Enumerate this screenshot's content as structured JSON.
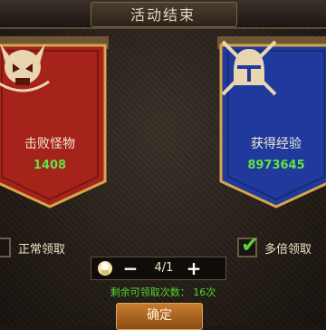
{
  "title": "活动结束",
  "left_banner": {
    "label": "击败怪物",
    "value": "1408",
    "icon": "demon-skull-icon",
    "color": "#b3261c"
  },
  "right_banner": {
    "label": "获得经验",
    "value": "8973645",
    "icon": "knight-helmet-swords-icon",
    "color": "#1f3a9c"
  },
  "options": {
    "normal": {
      "label": "正常领取",
      "checked": false
    },
    "multiple": {
      "label": "多倍领取",
      "checked": true
    }
  },
  "stepper": {
    "minus": "−",
    "value": "4/1",
    "plus": "+"
  },
  "remaining_text": "剩余可领取次数： 16次",
  "confirm_label": "确定"
}
